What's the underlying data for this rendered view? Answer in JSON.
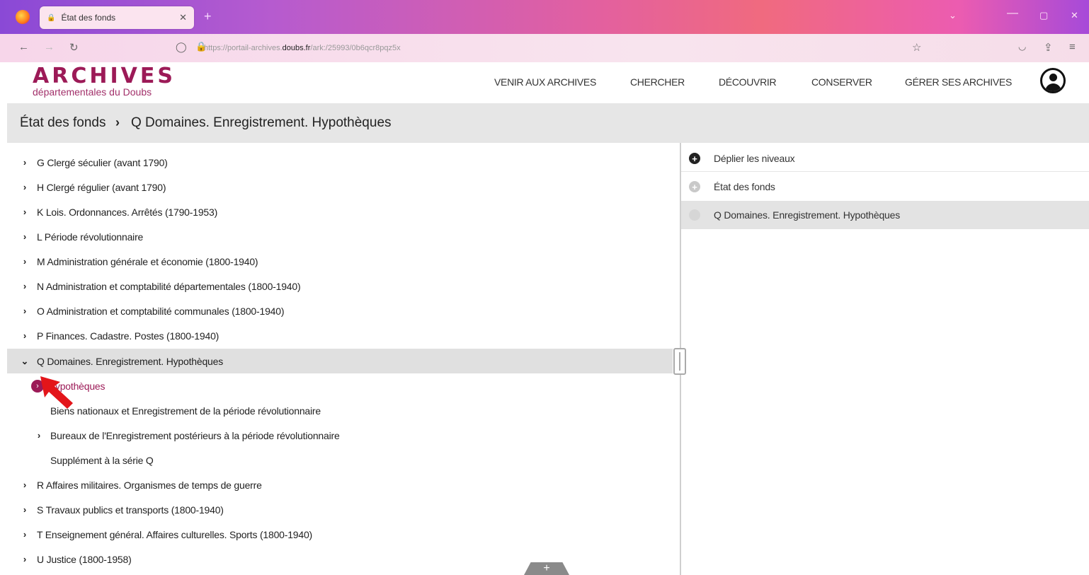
{
  "browser": {
    "tab_title": "État des fonds",
    "url_prefix": "https://portail-archives.",
    "url_domain": "doubs.fr",
    "url_suffix": "/ark:/25993/0b6qcr8pqz5x"
  },
  "site": {
    "logo_main": "ARCHIVES",
    "logo_sub": "départementales du Doubs",
    "nav": [
      "VENIR AUX ARCHIVES",
      "CHERCHER",
      "DÉCOUVRIR",
      "CONSERVER",
      "GÉRER SES ARCHIVES"
    ]
  },
  "breadcrumb": [
    "État des fonds",
    "Q Domaines. Enregistrement. Hypothèques"
  ],
  "tree": {
    "items": [
      "G Clergé séculier (avant 1790)",
      "H Clergé régulier (avant 1790)",
      "K Lois. Ordonnances. Arrêtés (1790-1953)",
      "L Période révolutionnaire",
      "M Administration générale et économie (1800-1940)",
      "N Administration et comptabilité départementales (1800-1940)",
      "O Administration et comptabilité communales (1800-1940)",
      "P Finances. Cadastre. Postes (1800-1940)",
      "Q Domaines. Enregistrement. Hypothèques",
      "R Affaires militaires. Organismes de temps de guerre",
      "S Travaux publics et transports (1800-1940)",
      "T Enseignement général. Affaires culturelles. Sports (1800-1940)",
      "U Justice (1800-1958)"
    ],
    "children": [
      "Hypothèques",
      "Biens nationaux et Enregistrement de la période révolutionnaire",
      "Bureaux de l'Enregistrement postérieurs à la période révolutionnaire",
      "Supplément à la série Q"
    ]
  },
  "right_panel": {
    "expand_label": "Déplier les niveaux",
    "root_label": "État des fonds",
    "current_label": "Q Domaines. Enregistrement. Hypothèques"
  },
  "fab_label": "+",
  "colors": {
    "brand": "#9c1a57",
    "selected_bg": "#e0e0e0",
    "crumb_bg": "#e6e6e6"
  }
}
